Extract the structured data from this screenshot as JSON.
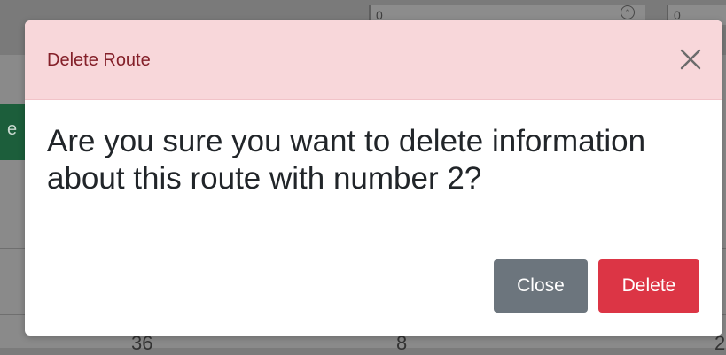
{
  "background": {
    "input_values": [
      "0",
      "0"
    ],
    "green_button_fragment": "e",
    "numbers": [
      "36",
      "8",
      "2"
    ]
  },
  "modal": {
    "title": "Delete Route",
    "message": "Are you sure you want to delete information about this route with number 2?",
    "buttons": {
      "close_label": "Close",
      "delete_label": "Delete"
    },
    "colors": {
      "header_bg": "#f8d7da",
      "header_text": "#842029",
      "close_button": "#6c757d",
      "delete_button": "#dc3545"
    },
    "icons": {
      "close": "close-icon"
    }
  }
}
